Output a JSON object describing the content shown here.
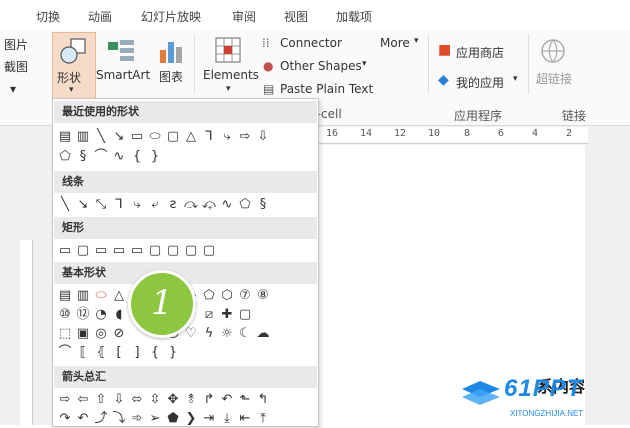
{
  "tabs": [
    "切换",
    "动画",
    "幻灯片放映",
    "审阅",
    "视图",
    "加载项"
  ],
  "ribbon": {
    "left_partial_1": "图片",
    "left_partial_2": "截图",
    "shapes": "形状",
    "smartart": "SmartArt",
    "chart": "图表",
    "elements": "Elements",
    "connector": "Connector",
    "other_shapes": "Other Shapes",
    "paste_plain": "Paste Plain Text",
    "more": "More",
    "app_store": "应用商店",
    "my_apps": "我的应用",
    "hyperlink": "超链接",
    "group_apps": "应用程序",
    "group_link": "链接",
    "group_cell_partial": "t-cell"
  },
  "ruler": [
    "16",
    "14",
    "12",
    "10",
    "8",
    "6",
    "4",
    "2"
  ],
  "shapes_panel": {
    "sections": [
      "最近使用的形状",
      "线条",
      "矩形",
      "基本形状",
      "箭头总汇"
    ]
  },
  "badge": "1",
  "watermark": {
    "brand": "61PPT",
    "site": "XITONGZHIJIA.NET",
    "slide_text_partial": "系内容"
  },
  "colors": {
    "badge": "#8dc63f",
    "watermark": "#1e88e5",
    "app_store_icon": "#e04a2a",
    "my_apps_icon": "#2a7fd4"
  }
}
